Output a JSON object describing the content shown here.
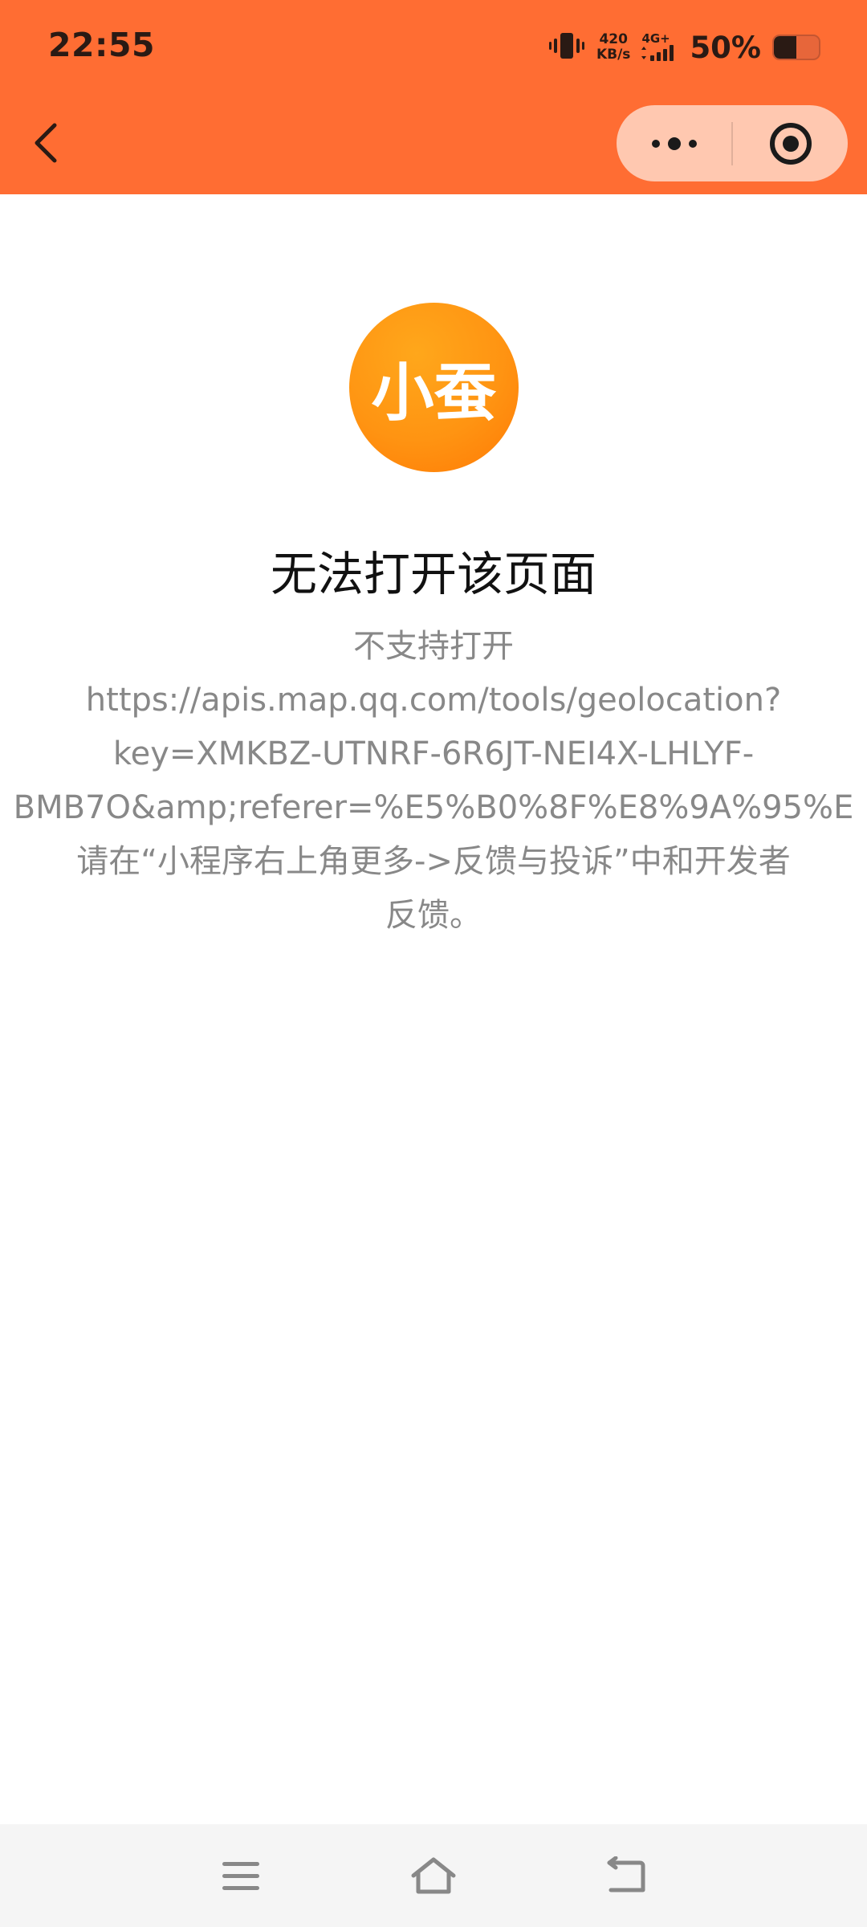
{
  "status_bar": {
    "time": "22:55",
    "net_speed_value": "420",
    "net_speed_unit": "KB/s",
    "network_type": "4G+",
    "battery_percent": "50%",
    "battery_level": 0.5,
    "icons": [
      "vibrate-icon",
      "signal-icon",
      "battery-icon"
    ]
  },
  "header": {
    "background_color": "#FF6D33",
    "back_icon": "back-chevron-icon",
    "capsule": {
      "more_icon": "more-dots-icon",
      "close_icon": "close-miniprogram-icon"
    }
  },
  "content": {
    "logo_text": "小蚕",
    "logo_color": "#FF9412",
    "title": "无法打开该页面",
    "message_lines": [
      "不支持打开",
      "https://apis.map.qq.com/tools/geolocation?",
      "key=XMKBZ-UTNRF-6R6JT-NEI4X-LHLYF-",
      "BMB7O&amp;referer=%E5%B0%8F%E8%9A%95%E",
      "请在“小程序右上角更多->反馈与投诉”中和开发者",
      "反馈。"
    ]
  },
  "nav_bar": {
    "icons": [
      "menu-icon",
      "home-icon",
      "back-icon"
    ]
  }
}
